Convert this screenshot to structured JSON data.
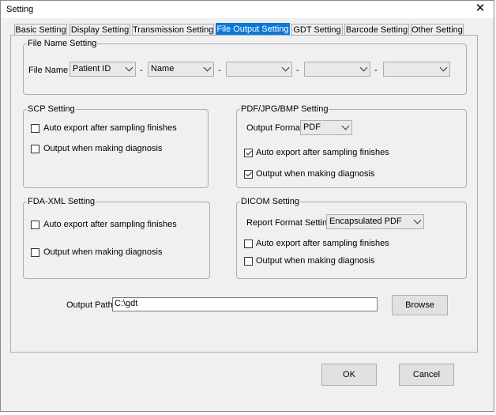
{
  "window": {
    "title": "Setting",
    "close_glyph": "✕"
  },
  "tabs": [
    {
      "label": "Basic Setting",
      "active": false
    },
    {
      "label": "Display Setting",
      "active": false
    },
    {
      "label": "Transmission Setting",
      "active": false
    },
    {
      "label": "File Output Setting",
      "active": true
    },
    {
      "label": "GDT Setting",
      "active": false
    },
    {
      "label": "Barcode Setting",
      "active": false
    },
    {
      "label": "Other Setting",
      "active": false
    }
  ],
  "file_name_setting": {
    "legend": "File Name Setting",
    "label": "File Name",
    "separator": "-",
    "parts": [
      "Patient ID",
      "Name",
      "",
      "",
      ""
    ]
  },
  "scp": {
    "legend": "SCP Setting",
    "auto_export": {
      "label": "Auto export after sampling finishes",
      "checked": false
    },
    "output_diagnosis": {
      "label": "Output when making diagnosis",
      "checked": false
    }
  },
  "pdf": {
    "legend": "PDF/JPG/BMP Setting",
    "format_label": "Output Format",
    "format_value": "PDF",
    "auto_export": {
      "label": "Auto export after sampling finishes",
      "checked": true
    },
    "output_diagnosis": {
      "label": "Output when making diagnosis",
      "checked": true
    }
  },
  "fda": {
    "legend": "FDA-XML Setting",
    "auto_export": {
      "label": "Auto export after sampling finishes",
      "checked": false
    },
    "output_diagnosis": {
      "label": "Output when making diagnosis",
      "checked": false
    }
  },
  "dicom": {
    "legend": "DICOM Setting",
    "format_label": "Report Format Setting",
    "format_value": "Encapsulated PDF",
    "auto_export": {
      "label": "Auto export after sampling finishes",
      "checked": false
    },
    "output_diagnosis": {
      "label": "Output when making diagnosis",
      "checked": false
    }
  },
  "output_path": {
    "label": "Output Path",
    "value": "C:\\gdt",
    "browse_label": "Browse"
  },
  "footer": {
    "ok_label": "OK",
    "cancel_label": "Cancel"
  }
}
